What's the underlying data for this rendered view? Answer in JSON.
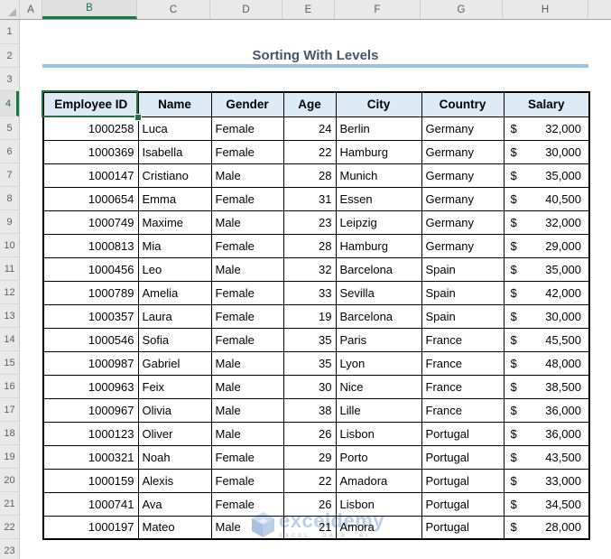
{
  "title": {
    "text": "Sorting With Levels"
  },
  "grid": {
    "column_letters": [
      "A",
      "B",
      "C",
      "D",
      "E",
      "F",
      "G",
      "H"
    ],
    "selected_column": "B",
    "row_numbers": [
      "1",
      "2",
      "3",
      "4",
      "5",
      "6",
      "7",
      "8",
      "9",
      "10",
      "11",
      "12",
      "13",
      "14",
      "15",
      "16",
      "17",
      "18",
      "19",
      "20",
      "21",
      "22",
      "23"
    ],
    "selected_row": "4",
    "selected_cell": "B4"
  },
  "table": {
    "headers": [
      "Employee ID",
      "Name",
      "Gender",
      "Age",
      "City",
      "Country",
      "Salary"
    ],
    "currency_symbol": "$",
    "rows": [
      {
        "employee_id": "1000258",
        "name": "Luca",
        "gender": "Female",
        "age": "24",
        "city": "Berlin",
        "country": "Germany",
        "salary": "32,000"
      },
      {
        "employee_id": "1000369",
        "name": "Isabella",
        "gender": "Female",
        "age": "22",
        "city": "Hamburg",
        "country": "Germany",
        "salary": "30,000"
      },
      {
        "employee_id": "1000147",
        "name": "Cristiano",
        "gender": "Male",
        "age": "28",
        "city": "Munich",
        "country": "Germany",
        "salary": "35,000"
      },
      {
        "employee_id": "1000654",
        "name": "Emma",
        "gender": "Female",
        "age": "31",
        "city": "Essen",
        "country": "Germany",
        "salary": "40,500"
      },
      {
        "employee_id": "1000749",
        "name": "Maxime",
        "gender": "Male",
        "age": "23",
        "city": "Leipzig",
        "country": "Germany",
        "salary": "32,000"
      },
      {
        "employee_id": "1000813",
        "name": "Mia",
        "gender": "Female",
        "age": "28",
        "city": "Hamburg",
        "country": "Germany",
        "salary": "29,000"
      },
      {
        "employee_id": "1000456",
        "name": "Leo",
        "gender": "Male",
        "age": "32",
        "city": "Barcelona",
        "country": "Spain",
        "salary": "35,000"
      },
      {
        "employee_id": "1000789",
        "name": "Amelia",
        "gender": "Female",
        "age": "33",
        "city": "Sevilla",
        "country": "Spain",
        "salary": "42,000"
      },
      {
        "employee_id": "1000357",
        "name": "Laura",
        "gender": "Female",
        "age": "19",
        "city": "Barcelona",
        "country": "Spain",
        "salary": "30,000"
      },
      {
        "employee_id": "1000546",
        "name": "Sofia",
        "gender": "Female",
        "age": "35",
        "city": "Paris",
        "country": "France",
        "salary": "45,500"
      },
      {
        "employee_id": "1000987",
        "name": "Gabriel",
        "gender": "Male",
        "age": "35",
        "city": "Lyon",
        "country": "France",
        "salary": "48,000"
      },
      {
        "employee_id": "1000963",
        "name": "Feix",
        "gender": "Male",
        "age": "30",
        "city": "Nice",
        "country": "France",
        "salary": "38,500"
      },
      {
        "employee_id": "1000967",
        "name": "Olivia",
        "gender": "Male",
        "age": "38",
        "city": "Lille",
        "country": "France",
        "salary": "36,000"
      },
      {
        "employee_id": "1000123",
        "name": "Oliver",
        "gender": "Male",
        "age": "26",
        "city": "Lisbon",
        "country": "Portugal",
        "salary": "36,000"
      },
      {
        "employee_id": "1000321",
        "name": "Noah",
        "gender": "Female",
        "age": "29",
        "city": "Porto",
        "country": "Portugal",
        "salary": "43,500"
      },
      {
        "employee_id": "1000159",
        "name": "Alexis",
        "gender": "Female",
        "age": "22",
        "city": "Amadora",
        "country": "Portugal",
        "salary": "33,000"
      },
      {
        "employee_id": "1000741",
        "name": "Ava",
        "gender": "Female",
        "age": "26",
        "city": "Lisbon",
        "country": "Portugal",
        "salary": "34,500"
      },
      {
        "employee_id": "1000197",
        "name": "Mateo",
        "gender": "Male",
        "age": "21",
        "city": "Amora",
        "country": "Portugal",
        "salary": "28,000"
      }
    ]
  },
  "watermark": {
    "brand": "exceldemy",
    "tagline": "EXCEL · DATA · BI"
  },
  "colors": {
    "selection_green": "#217346",
    "table_header_fill": "#ddebf7",
    "title_text": "#44546a",
    "title_underline": "#9cc2e5",
    "gutter_background": "#e9e9e9",
    "cell_border": "#000000",
    "watermark_blue": "#b3c9e6"
  }
}
